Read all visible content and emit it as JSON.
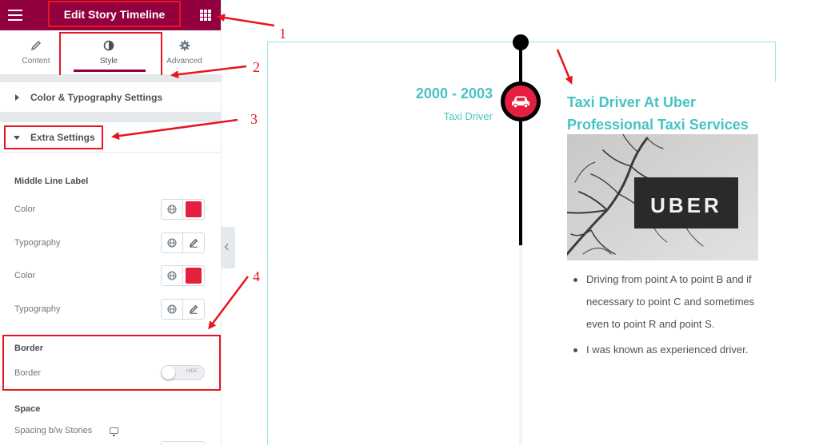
{
  "header": {
    "title": "Edit Story Timeline"
  },
  "tabs": [
    {
      "label": "Content",
      "icon": "pencil-icon"
    },
    {
      "label": "Style",
      "icon": "contrast-icon"
    },
    {
      "label": "Advanced",
      "icon": "gear-icon"
    }
  ],
  "sections": {
    "color_typography": "Color & Typography Settings",
    "extra_settings": "Extra Settings"
  },
  "middle_line_label": {
    "heading": "Middle Line Label",
    "color_label_1": "Color",
    "typography_label_1": "Typography",
    "color_label_2": "Color",
    "typography_label_2": "Typography",
    "swatch_color": "#e5203f"
  },
  "border_group": {
    "heading": "Border",
    "label": "Border",
    "toggle_text": "HIDE"
  },
  "space_group": {
    "heading": "Space",
    "spacing_label": "Spacing b/w Stories"
  },
  "timeline": {
    "year": "2000 - 2003",
    "subtitle": "Taxi Driver",
    "title": "Taxi Driver At Uber Professional Taxi Services",
    "image_sign_text": "UBER",
    "bullets": [
      "Driving from point A to point B and if necessary to point C and sometimes even to point R and point S.",
      "I was known as experienced driver."
    ],
    "accent_color": "#46c3c4",
    "marker_color": "#e5203f"
  },
  "annotations": [
    "1",
    "2",
    "3",
    "4"
  ],
  "colors": {
    "brand": "#93003f",
    "annotation": "#e5161f"
  }
}
